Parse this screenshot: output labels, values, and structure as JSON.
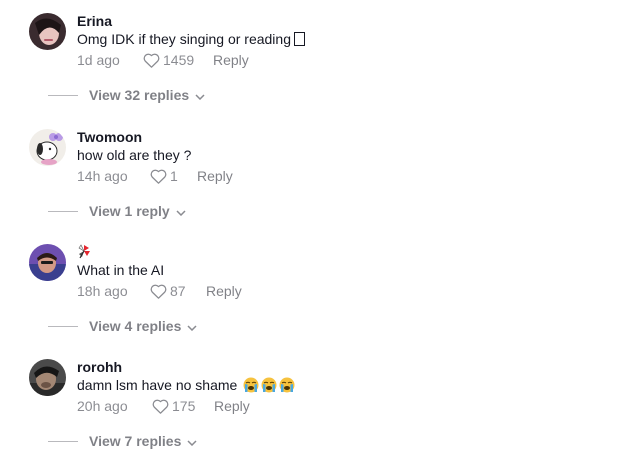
{
  "comments": [
    {
      "username": "Erina",
      "text": "Omg IDK if they singing or reading",
      "time": "1d ago",
      "likes": "1459",
      "reply_label": "Reply",
      "view_replies": "View 32 replies"
    },
    {
      "username": "Twomoon",
      "text": "how old are they ?",
      "time": "14h ago",
      "likes": "1",
      "reply_label": "Reply",
      "view_replies": "View 1 reply"
    },
    {
      "username": "",
      "text": "What in the AI",
      "time": "18h ago",
      "likes": "87",
      "reply_label": "Reply",
      "view_replies": "View 4 replies"
    },
    {
      "username": "rorohh",
      "text": "damn lsm have no shame",
      "time": "20h ago",
      "likes": "175",
      "reply_label": "Reply",
      "view_replies": "View 7 replies"
    }
  ],
  "icons": {
    "like": "heart-outline-icon",
    "expand": "chevron-down-icon",
    "username_emoji": "pinwheel-emoji",
    "crying_emoji": "loudly-crying-face-emoji",
    "missing_glyph": "replacement-box-glyph"
  },
  "colors": {
    "text": "#161823",
    "muted": "#8a8b91",
    "background": "#ffffff"
  }
}
